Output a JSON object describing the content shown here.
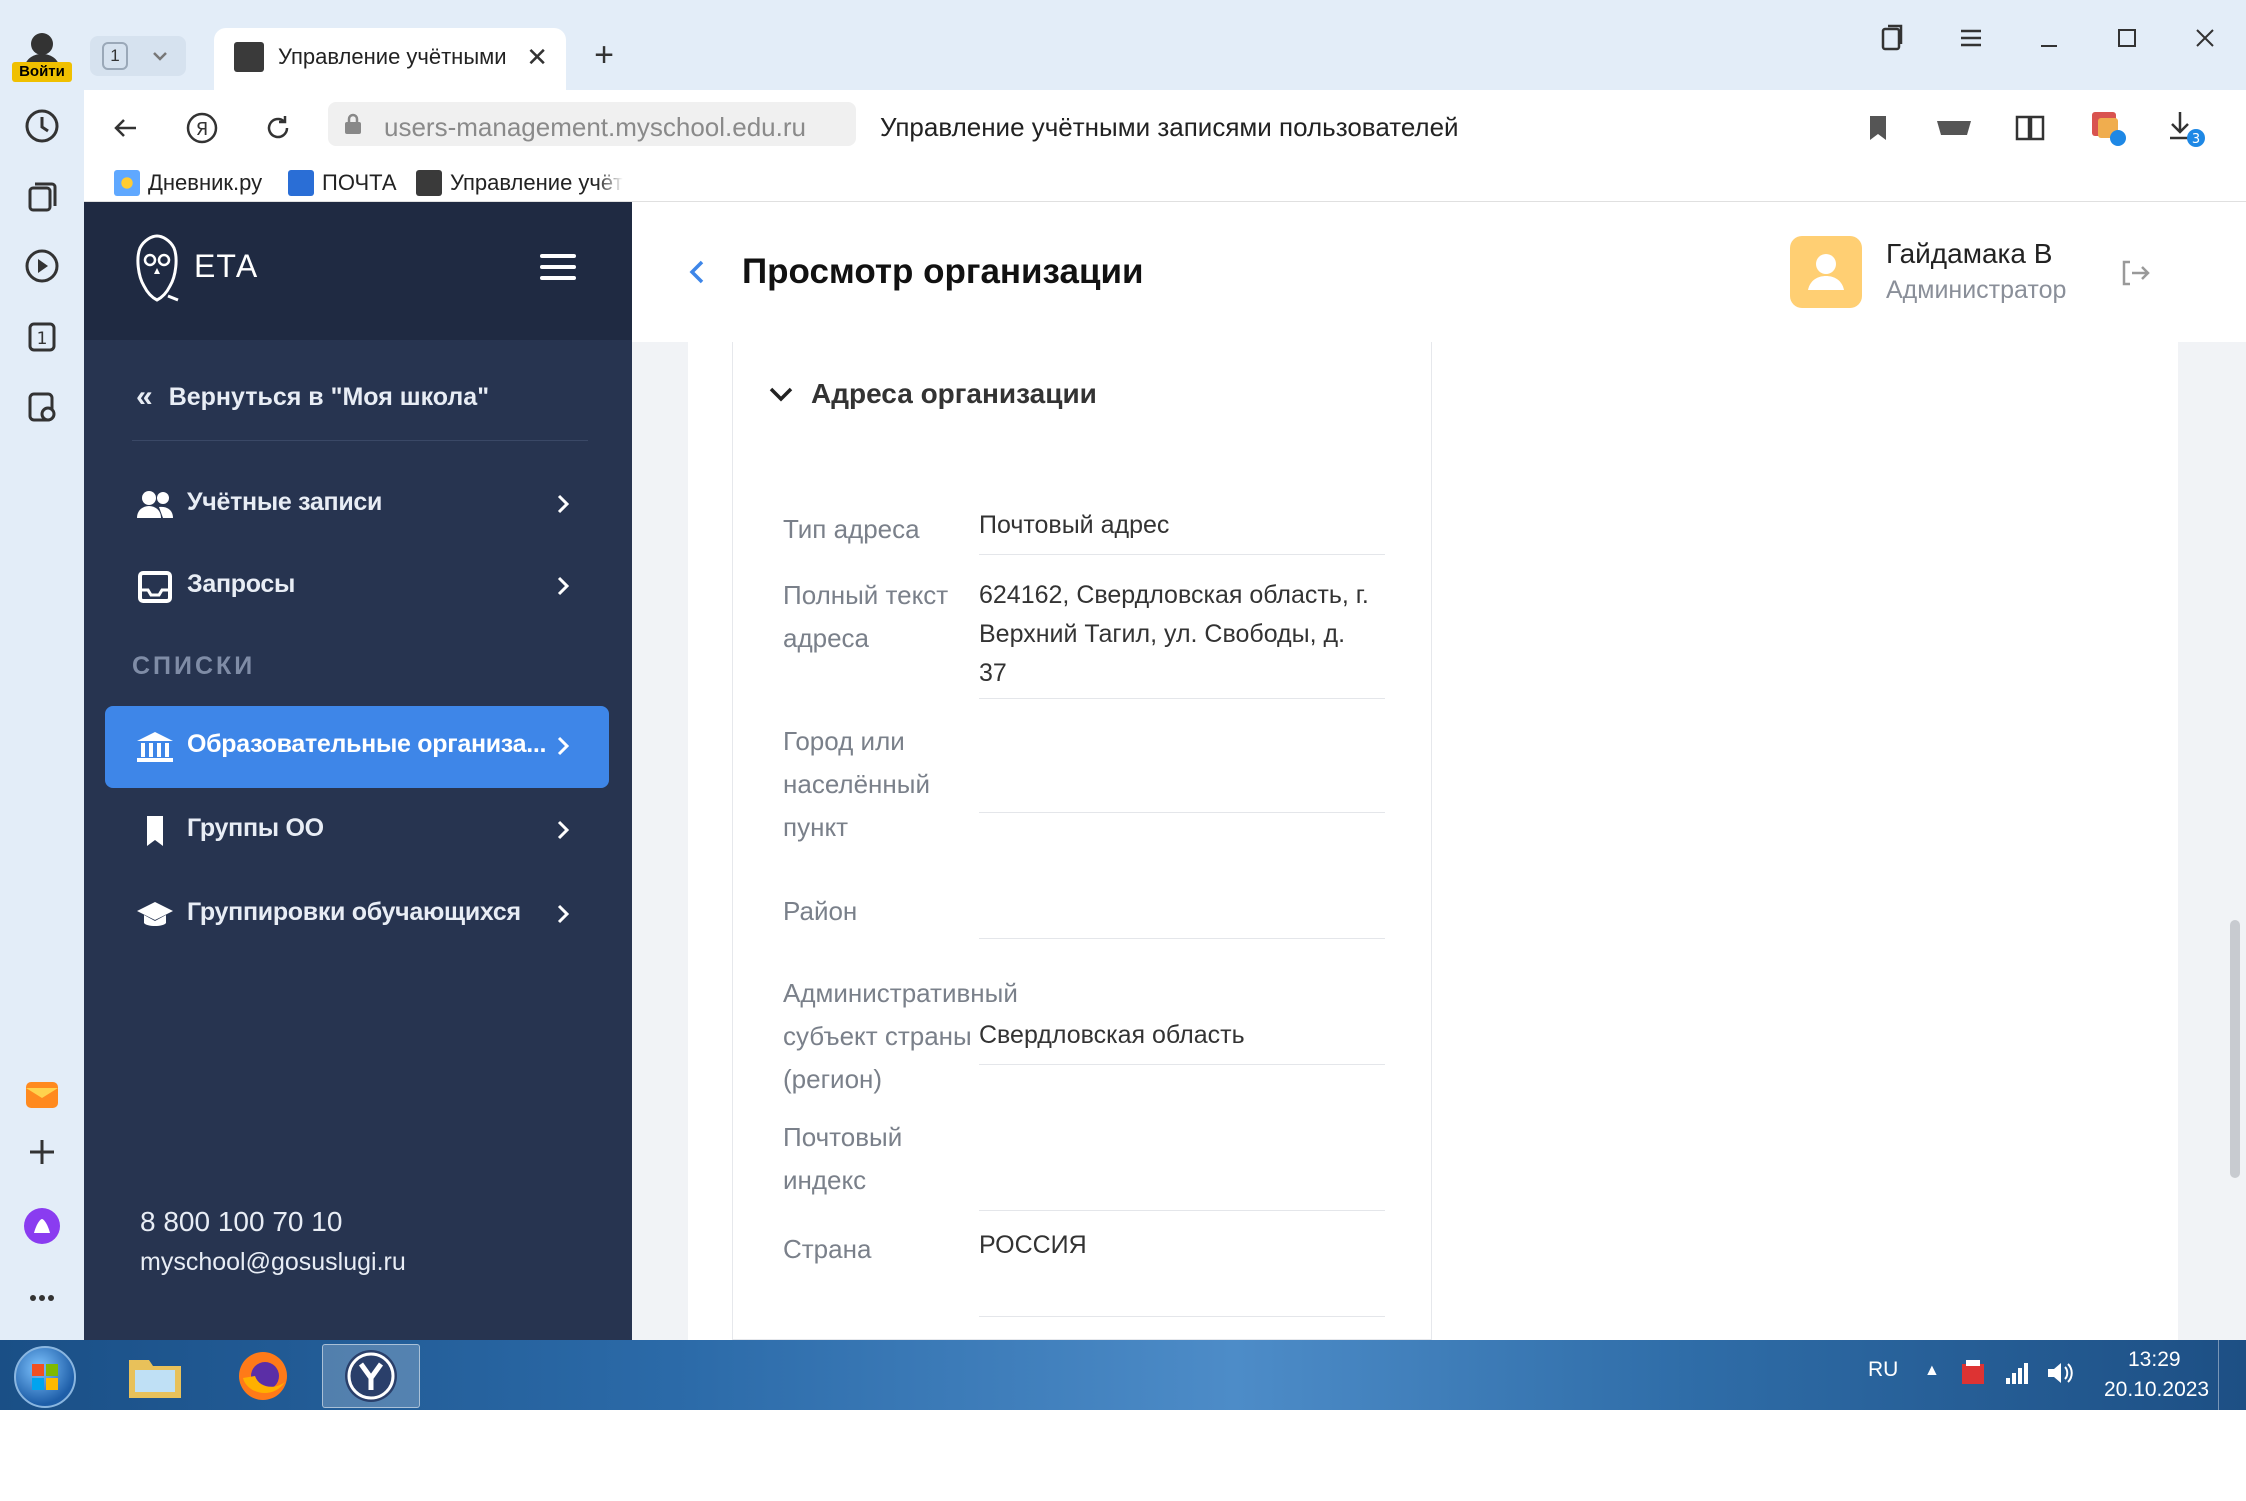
{
  "browser": {
    "login_label": "Войти",
    "tab_counter": "1",
    "tab_title": "Управление учётными",
    "url": "users-management.myschool.edu.ru",
    "page_title": "Управление учётными записями пользователей",
    "download_badge": "3",
    "bookmarks": [
      {
        "label": "Дневник.ру",
        "icon": "diary-icon"
      },
      {
        "label": "ПОЧТА",
        "icon": "mail-icon"
      },
      {
        "label": "Управление учёт",
        "icon": "site-favicon"
      }
    ]
  },
  "app": {
    "logo_text": "ЕТА",
    "back_link": "Вернуться в \"Моя школа\"",
    "sidebar": {
      "items": [
        {
          "label": "Учётные записи",
          "icon": "users-icon"
        },
        {
          "label": "Запросы",
          "icon": "inbox-icon"
        }
      ],
      "section_label": "СПИСКИ",
      "list_items": [
        {
          "label": "Образовательные организа...",
          "icon": "institution-icon",
          "active": true
        },
        {
          "label": "Группы ОО",
          "icon": "bookmark-icon",
          "active": false
        },
        {
          "label": "Группировки обучающихся",
          "icon": "graduation-cap-icon",
          "active": false
        }
      ],
      "support_phone": "8 800 100 70 10",
      "support_email": "myschool@gosuslugi.ru"
    },
    "header": {
      "title": "Просмотр организации",
      "user_name": "Гайдамака В",
      "user_role": "Администратор"
    },
    "address_section": {
      "title": "Адреса организации",
      "fields": [
        {
          "label": "Тип адреса",
          "value": "Почтовый адрес"
        },
        {
          "label": "Полный текст адреса",
          "value": "624162, Свердловская область, г. Верхний Тагил, ул. Свободы, д. 37"
        },
        {
          "label": "Город или населённый пункт",
          "value": ""
        },
        {
          "label": "Район",
          "value": ""
        },
        {
          "label": "Административный субъект страны (регион)",
          "value": "Свердловская область"
        },
        {
          "label": "Почтовый индекс",
          "value": ""
        },
        {
          "label": "Страна",
          "value": "РОССИЯ"
        }
      ]
    }
  },
  "taskbar": {
    "language": "RU",
    "time": "13:29",
    "date": "20.10.2023"
  },
  "colors": {
    "sidebar_bg": "#273450",
    "sidebar_head_bg": "#1f2a42",
    "active_item": "#3e86e8",
    "avatar": "#ffcf73",
    "browser_chrome": "#e3edf8"
  }
}
